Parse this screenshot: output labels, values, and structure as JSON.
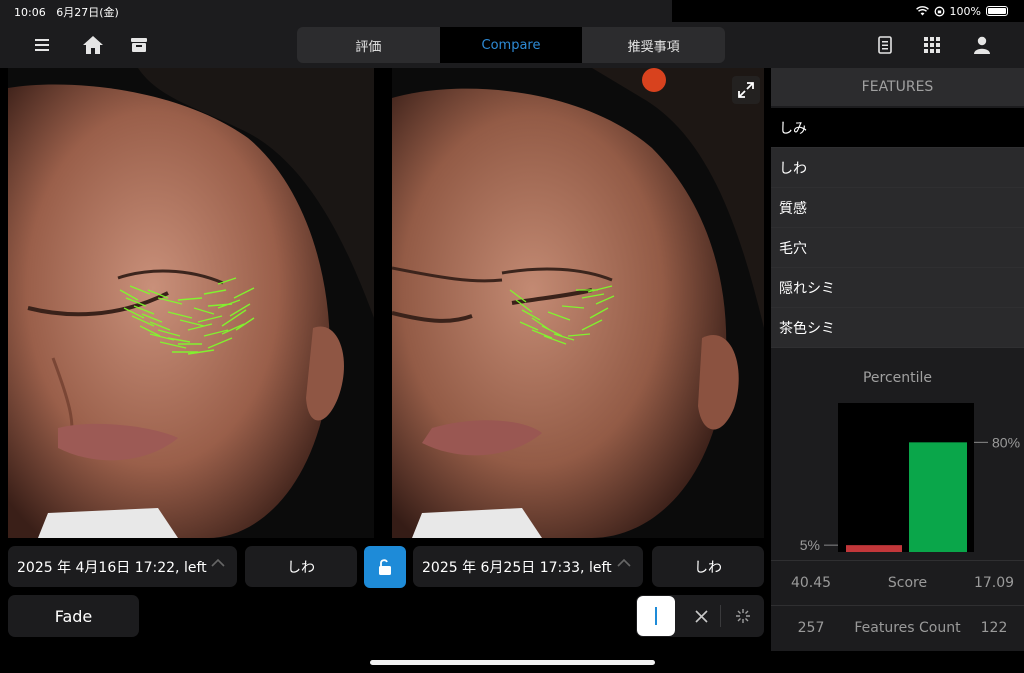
{
  "status": {
    "time": "10:06",
    "date": "6月27日(金)",
    "battery": "100%"
  },
  "toolbar": {
    "tabs": [
      {
        "label": "評価",
        "active": false
      },
      {
        "label": "Compare",
        "active": true
      },
      {
        "label": "推奨事項",
        "active": false
      }
    ],
    "icons": [
      "menu-icon",
      "home-icon",
      "archive-box-icon",
      "document-icon",
      "grid-icon",
      "user-icon"
    ]
  },
  "left_panel": {
    "date": "2025 年 4月16日 17:22, left",
    "feature": "しわ"
  },
  "right_panel": {
    "date": "2025 年 6月25日 17:33, left",
    "feature": "しわ"
  },
  "fade_label": "Fade",
  "sidebar": {
    "header": "FEATURES",
    "features": [
      {
        "label": "しみ",
        "selected": true
      },
      {
        "label": "しわ",
        "selected": false
      },
      {
        "label": "質感",
        "selected": false
      },
      {
        "label": "毛穴",
        "selected": false
      },
      {
        "label": "隠れシミ",
        "selected": false
      },
      {
        "label": "茶色シミ",
        "selected": false
      }
    ],
    "percentile_title": "Percentile",
    "score": {
      "label": "Score",
      "left": "40.45",
      "right": "17.09"
    },
    "features_count": {
      "label": "Features Count",
      "left": "257",
      "right": "122"
    }
  },
  "chart_data": {
    "type": "bar",
    "title": "Percentile",
    "categories": [
      "2025年4月16日",
      "2025年6月25日"
    ],
    "values": [
      5,
      80
    ],
    "tick_labels": [
      "5%",
      "80%"
    ],
    "colors": [
      "#c2373a",
      "#0aa64a"
    ],
    "ylim": [
      0,
      100
    ]
  }
}
